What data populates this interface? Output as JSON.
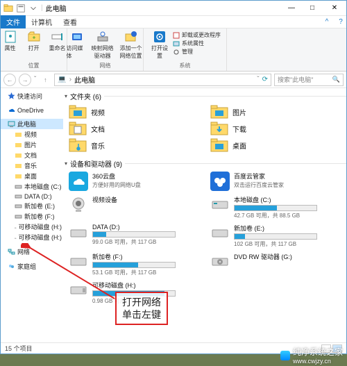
{
  "title": "此电脑",
  "qat_sep": "|",
  "winbtns": {
    "min": "—",
    "max": "□",
    "close": "✕"
  },
  "menubar": {
    "file": "文件",
    "computer": "计算机",
    "view": "查看",
    "help": "?",
    "expand": "^"
  },
  "ribbon": {
    "g1": {
      "label": "位置",
      "b1": "属性",
      "b2": "打开",
      "b3": "重命名"
    },
    "g2": {
      "label": "网络",
      "b1": "访问媒体",
      "b2": "映射网络驱动器",
      "b3": "添加一个网络位置"
    },
    "g3": {
      "label": "系统",
      "b1": "打开设置",
      "l1": "卸载或更改程序",
      "l2": "系统属性",
      "l3": "管理"
    }
  },
  "nav": {
    "back": "←",
    "fwd": "→",
    "up": "↑",
    "recents": "ˇ"
  },
  "address": {
    "icon": "💻",
    "text": "此电脑",
    "chev": "›",
    "refresh": "⟳"
  },
  "search": {
    "placeholder": "搜索\"此电脑\"",
    "icon": "🔍"
  },
  "navpane": {
    "quick": "快速访问",
    "onedrive": "OneDrive",
    "thispc": "此电脑",
    "videos": "视频",
    "pictures": "图片",
    "documents": "文档",
    "music": "音乐",
    "desktop": "桌面",
    "c": "本地磁盘 (C:)",
    "d": "DATA (D:)",
    "e": "新加卷 (E:)",
    "f": "新加卷 (F:)",
    "h": "可移动磁盘 (H:)",
    "h2": "可移动磁盘 (H:)",
    "network": "网络",
    "homegroup": "家庭组"
  },
  "groups": {
    "folders": "文件夹 (6)",
    "devices": "设备和驱动器 (9)"
  },
  "folders": {
    "videos": "视频",
    "pictures": "图片",
    "documents": "文档",
    "downloads": "下载",
    "music": "音乐",
    "desktop": "桌面"
  },
  "devices": {
    "d1": {
      "name": "360云盘",
      "sub": "方便好用的网络U盘"
    },
    "d2": {
      "name": "百度云管家",
      "sub": "双击运行百度云管家"
    },
    "d3": {
      "name": "视频设备",
      "sub": ""
    },
    "d4": {
      "name": "本地磁盘 (C:)",
      "stat": "42.7 GB 可用，共 88.5 GB",
      "fill": 52
    },
    "d5": {
      "name": "DATA (D:)",
      "stat": "99.0 GB 可用，共 117 GB",
      "fill": 16
    },
    "d6": {
      "name": "新加卷 (E:)",
      "stat": "102 GB 可用，共 117 GB",
      "fill": 13
    },
    "d7": {
      "name": "新加卷 (F:)",
      "stat": "53.1 GB 可用，共 117 GB",
      "fill": 55
    },
    "d8": {
      "name": "DVD RW 驱动器 (G:)",
      "stat": ""
    },
    "d9": {
      "name": "可移动磁盘 (H:)",
      "stat": "0.98 GB 可用，共 7.60 GB",
      "fill": 87
    }
  },
  "status": {
    "count": "15 个项目"
  },
  "callout": {
    "l1": "打开网络",
    "l2": "单击左键"
  },
  "watermark": {
    "t1": "纯净系统之家",
    "t2": "www.cwjzy.cn"
  }
}
